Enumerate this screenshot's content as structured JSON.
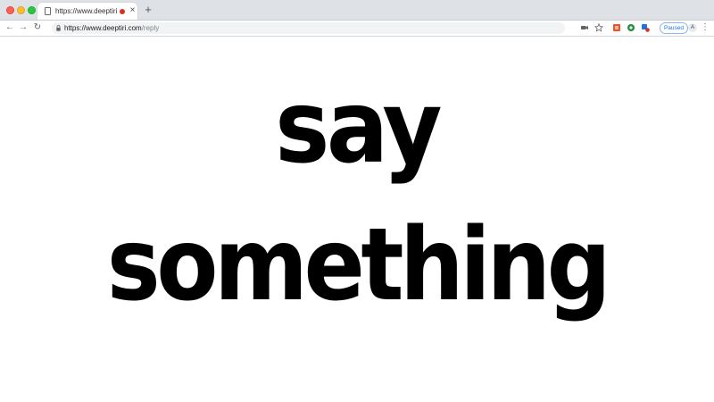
{
  "browser": {
    "tab": {
      "title": "https://www.deeptiri.com/",
      "close_glyph": "×"
    },
    "new_tab_glyph": "+",
    "toolbar": {
      "back_glyph": "←",
      "forward_glyph": "→",
      "reload_glyph": "↻",
      "url_host": "https://www.deeptiri.com",
      "url_path": "/reply",
      "profile_status": "Paused",
      "avatar_initial": "A",
      "menu_glyph": "⋮"
    },
    "icons": [
      "lock-icon",
      "camera-icon",
      "star-icon",
      "extension-orange-icon",
      "extension-green-icon",
      "extension-blue-icon"
    ],
    "colors": {
      "record_dot": "#d93025",
      "paused_text": "#1a73e8"
    }
  },
  "page": {
    "line1": "say",
    "line2": "something"
  }
}
